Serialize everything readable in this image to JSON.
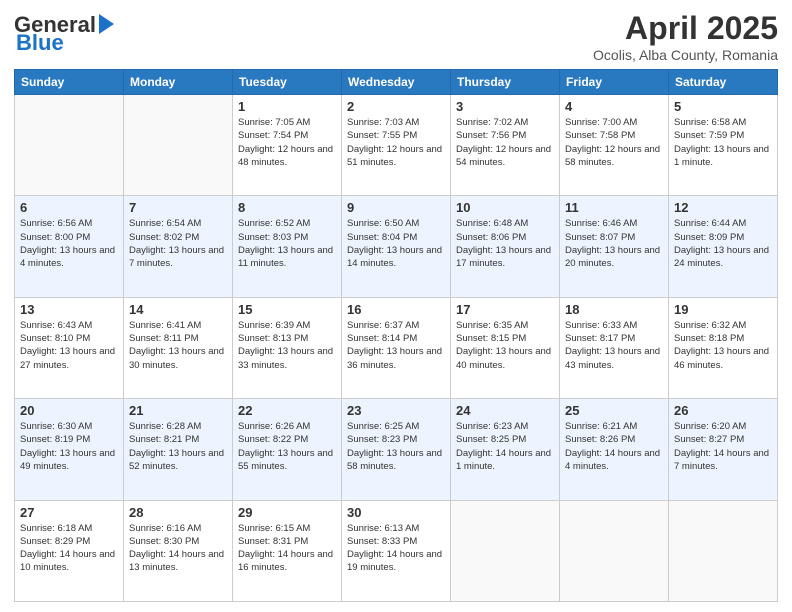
{
  "header": {
    "logo_general": "General",
    "logo_blue": "Blue",
    "title": "April 2025",
    "subtitle": "Ocolis, Alba County, Romania"
  },
  "days_of_week": [
    "Sunday",
    "Monday",
    "Tuesday",
    "Wednesday",
    "Thursday",
    "Friday",
    "Saturday"
  ],
  "weeks": [
    [
      {
        "day": "",
        "sunrise": "",
        "sunset": "",
        "daylight": ""
      },
      {
        "day": "",
        "sunrise": "",
        "sunset": "",
        "daylight": ""
      },
      {
        "day": "1",
        "sunrise": "Sunrise: 7:05 AM",
        "sunset": "Sunset: 7:54 PM",
        "daylight": "Daylight: 12 hours and 48 minutes."
      },
      {
        "day": "2",
        "sunrise": "Sunrise: 7:03 AM",
        "sunset": "Sunset: 7:55 PM",
        "daylight": "Daylight: 12 hours and 51 minutes."
      },
      {
        "day": "3",
        "sunrise": "Sunrise: 7:02 AM",
        "sunset": "Sunset: 7:56 PM",
        "daylight": "Daylight: 12 hours and 54 minutes."
      },
      {
        "day": "4",
        "sunrise": "Sunrise: 7:00 AM",
        "sunset": "Sunset: 7:58 PM",
        "daylight": "Daylight: 12 hours and 58 minutes."
      },
      {
        "day": "5",
        "sunrise": "Sunrise: 6:58 AM",
        "sunset": "Sunset: 7:59 PM",
        "daylight": "Daylight: 13 hours and 1 minute."
      }
    ],
    [
      {
        "day": "6",
        "sunrise": "Sunrise: 6:56 AM",
        "sunset": "Sunset: 8:00 PM",
        "daylight": "Daylight: 13 hours and 4 minutes."
      },
      {
        "day": "7",
        "sunrise": "Sunrise: 6:54 AM",
        "sunset": "Sunset: 8:02 PM",
        "daylight": "Daylight: 13 hours and 7 minutes."
      },
      {
        "day": "8",
        "sunrise": "Sunrise: 6:52 AM",
        "sunset": "Sunset: 8:03 PM",
        "daylight": "Daylight: 13 hours and 11 minutes."
      },
      {
        "day": "9",
        "sunrise": "Sunrise: 6:50 AM",
        "sunset": "Sunset: 8:04 PM",
        "daylight": "Daylight: 13 hours and 14 minutes."
      },
      {
        "day": "10",
        "sunrise": "Sunrise: 6:48 AM",
        "sunset": "Sunset: 8:06 PM",
        "daylight": "Daylight: 13 hours and 17 minutes."
      },
      {
        "day": "11",
        "sunrise": "Sunrise: 6:46 AM",
        "sunset": "Sunset: 8:07 PM",
        "daylight": "Daylight: 13 hours and 20 minutes."
      },
      {
        "day": "12",
        "sunrise": "Sunrise: 6:44 AM",
        "sunset": "Sunset: 8:09 PM",
        "daylight": "Daylight: 13 hours and 24 minutes."
      }
    ],
    [
      {
        "day": "13",
        "sunrise": "Sunrise: 6:43 AM",
        "sunset": "Sunset: 8:10 PM",
        "daylight": "Daylight: 13 hours and 27 minutes."
      },
      {
        "day": "14",
        "sunrise": "Sunrise: 6:41 AM",
        "sunset": "Sunset: 8:11 PM",
        "daylight": "Daylight: 13 hours and 30 minutes."
      },
      {
        "day": "15",
        "sunrise": "Sunrise: 6:39 AM",
        "sunset": "Sunset: 8:13 PM",
        "daylight": "Daylight: 13 hours and 33 minutes."
      },
      {
        "day": "16",
        "sunrise": "Sunrise: 6:37 AM",
        "sunset": "Sunset: 8:14 PM",
        "daylight": "Daylight: 13 hours and 36 minutes."
      },
      {
        "day": "17",
        "sunrise": "Sunrise: 6:35 AM",
        "sunset": "Sunset: 8:15 PM",
        "daylight": "Daylight: 13 hours and 40 minutes."
      },
      {
        "day": "18",
        "sunrise": "Sunrise: 6:33 AM",
        "sunset": "Sunset: 8:17 PM",
        "daylight": "Daylight: 13 hours and 43 minutes."
      },
      {
        "day": "19",
        "sunrise": "Sunrise: 6:32 AM",
        "sunset": "Sunset: 8:18 PM",
        "daylight": "Daylight: 13 hours and 46 minutes."
      }
    ],
    [
      {
        "day": "20",
        "sunrise": "Sunrise: 6:30 AM",
        "sunset": "Sunset: 8:19 PM",
        "daylight": "Daylight: 13 hours and 49 minutes."
      },
      {
        "day": "21",
        "sunrise": "Sunrise: 6:28 AM",
        "sunset": "Sunset: 8:21 PM",
        "daylight": "Daylight: 13 hours and 52 minutes."
      },
      {
        "day": "22",
        "sunrise": "Sunrise: 6:26 AM",
        "sunset": "Sunset: 8:22 PM",
        "daylight": "Daylight: 13 hours and 55 minutes."
      },
      {
        "day": "23",
        "sunrise": "Sunrise: 6:25 AM",
        "sunset": "Sunset: 8:23 PM",
        "daylight": "Daylight: 13 hours and 58 minutes."
      },
      {
        "day": "24",
        "sunrise": "Sunrise: 6:23 AM",
        "sunset": "Sunset: 8:25 PM",
        "daylight": "Daylight: 14 hours and 1 minute."
      },
      {
        "day": "25",
        "sunrise": "Sunrise: 6:21 AM",
        "sunset": "Sunset: 8:26 PM",
        "daylight": "Daylight: 14 hours and 4 minutes."
      },
      {
        "day": "26",
        "sunrise": "Sunrise: 6:20 AM",
        "sunset": "Sunset: 8:27 PM",
        "daylight": "Daylight: 14 hours and 7 minutes."
      }
    ],
    [
      {
        "day": "27",
        "sunrise": "Sunrise: 6:18 AM",
        "sunset": "Sunset: 8:29 PM",
        "daylight": "Daylight: 14 hours and 10 minutes."
      },
      {
        "day": "28",
        "sunrise": "Sunrise: 6:16 AM",
        "sunset": "Sunset: 8:30 PM",
        "daylight": "Daylight: 14 hours and 13 minutes."
      },
      {
        "day": "29",
        "sunrise": "Sunrise: 6:15 AM",
        "sunset": "Sunset: 8:31 PM",
        "daylight": "Daylight: 14 hours and 16 minutes."
      },
      {
        "day": "30",
        "sunrise": "Sunrise: 6:13 AM",
        "sunset": "Sunset: 8:33 PM",
        "daylight": "Daylight: 14 hours and 19 minutes."
      },
      {
        "day": "",
        "sunrise": "",
        "sunset": "",
        "daylight": ""
      },
      {
        "day": "",
        "sunrise": "",
        "sunset": "",
        "daylight": ""
      },
      {
        "day": "",
        "sunrise": "",
        "sunset": "",
        "daylight": ""
      }
    ]
  ]
}
